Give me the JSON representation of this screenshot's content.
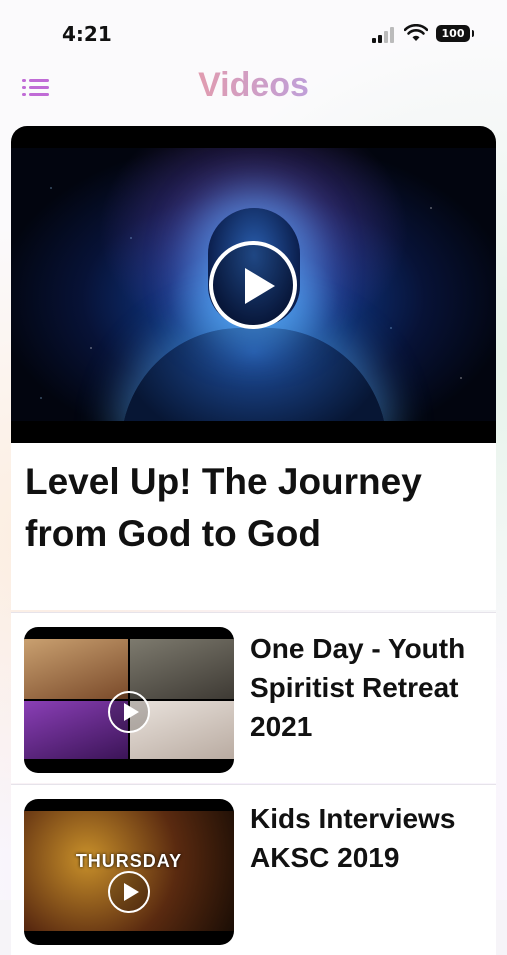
{
  "status_bar": {
    "time": "4:21",
    "battery": "100"
  },
  "nav": {
    "title": "Videos",
    "menu_icon": "menu-icon"
  },
  "featured": {
    "title": "Level Up! The Journey from God to God",
    "icon": "play-icon"
  },
  "videos": [
    {
      "title": "One Day - Youth Spiritist Retreat 2021",
      "icon": "play-icon"
    },
    {
      "title": "Kids Interviews AKSC 2019",
      "overlay_text": "THURSDAY",
      "icon": "play-icon"
    }
  ],
  "colors": {
    "title_gradient": [
      "#f2b07a",
      "#e79ba8",
      "#b9a0e0",
      "#8fc9de"
    ],
    "menu_icon": "#c06bd6"
  }
}
